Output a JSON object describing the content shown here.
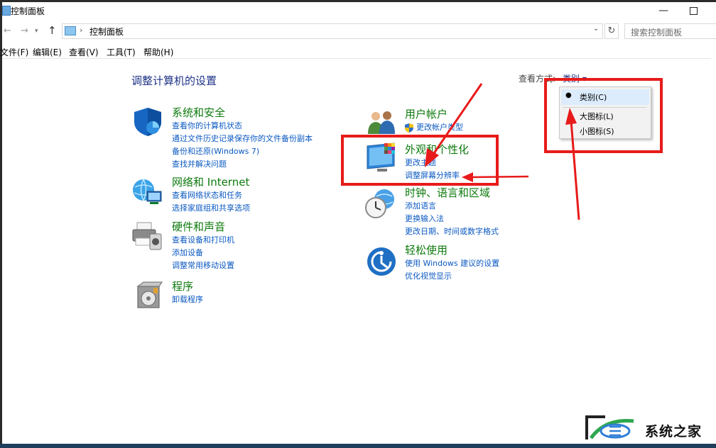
{
  "window": {
    "title": "控制面板"
  },
  "address": {
    "path": "控制面板",
    "search_placeholder": "搜索控制面板"
  },
  "menu": [
    "文件(F)",
    "编辑(E)",
    "查看(V)",
    "工具(T)",
    "帮助(H)"
  ],
  "main": {
    "heading": "调整计算机的设置",
    "view_by_label": "查看方式:",
    "view_by_value": "类别 ▾"
  },
  "categories": [
    {
      "id": "system",
      "icon": "shield-icon",
      "title": "系统和安全",
      "links": [
        "查看你的计算机状态",
        "通过文件历史记录保存你的文件备份副本",
        "备份和还原(Windows 7)",
        "查找并解决问题"
      ]
    },
    {
      "id": "network",
      "icon": "network-globe-icon",
      "title": "网络和 Internet",
      "links": [
        "查看网络状态和任务",
        "选择家庭组和共享选项"
      ]
    },
    {
      "id": "hardware",
      "icon": "printer-icon",
      "title": "硬件和声音",
      "links": [
        "查看设备和打印机",
        "添加设备",
        "调整常用移动设置"
      ]
    },
    {
      "id": "programs",
      "icon": "programs-box-icon",
      "title": "程序",
      "links": [
        "卸载程序"
      ]
    },
    {
      "id": "user",
      "icon": "users-icon",
      "title": "用户帐户",
      "links": [
        "更改帐户类型"
      ]
    },
    {
      "id": "appearance",
      "icon": "monitor-palette-icon",
      "title": "外观和个性化",
      "links": [
        "更改主题",
        "调整屏幕分辨率"
      ]
    },
    {
      "id": "clock",
      "icon": "clock-globe-icon",
      "title": "时钟、语言和区域",
      "links": [
        "添加语言",
        "更换输入法",
        "更改日期、时间或数字格式"
      ]
    },
    {
      "id": "ease",
      "icon": "ease-of-access-icon",
      "title": "轻松使用",
      "links": [
        "使用 Windows 建议的设置",
        "优化视觉显示"
      ]
    }
  ],
  "dropdown": {
    "options": [
      "类别(C)",
      "大图标(L)",
      "小图标(S)"
    ],
    "selected": "类别(C)"
  },
  "watermark": {
    "text": "系统之家"
  },
  "colors": {
    "annotation_red": "#e81a1a",
    "link_blue": "#0b59c2",
    "title_green": "#0d7a0d",
    "heading_blue": "#1e3287"
  }
}
